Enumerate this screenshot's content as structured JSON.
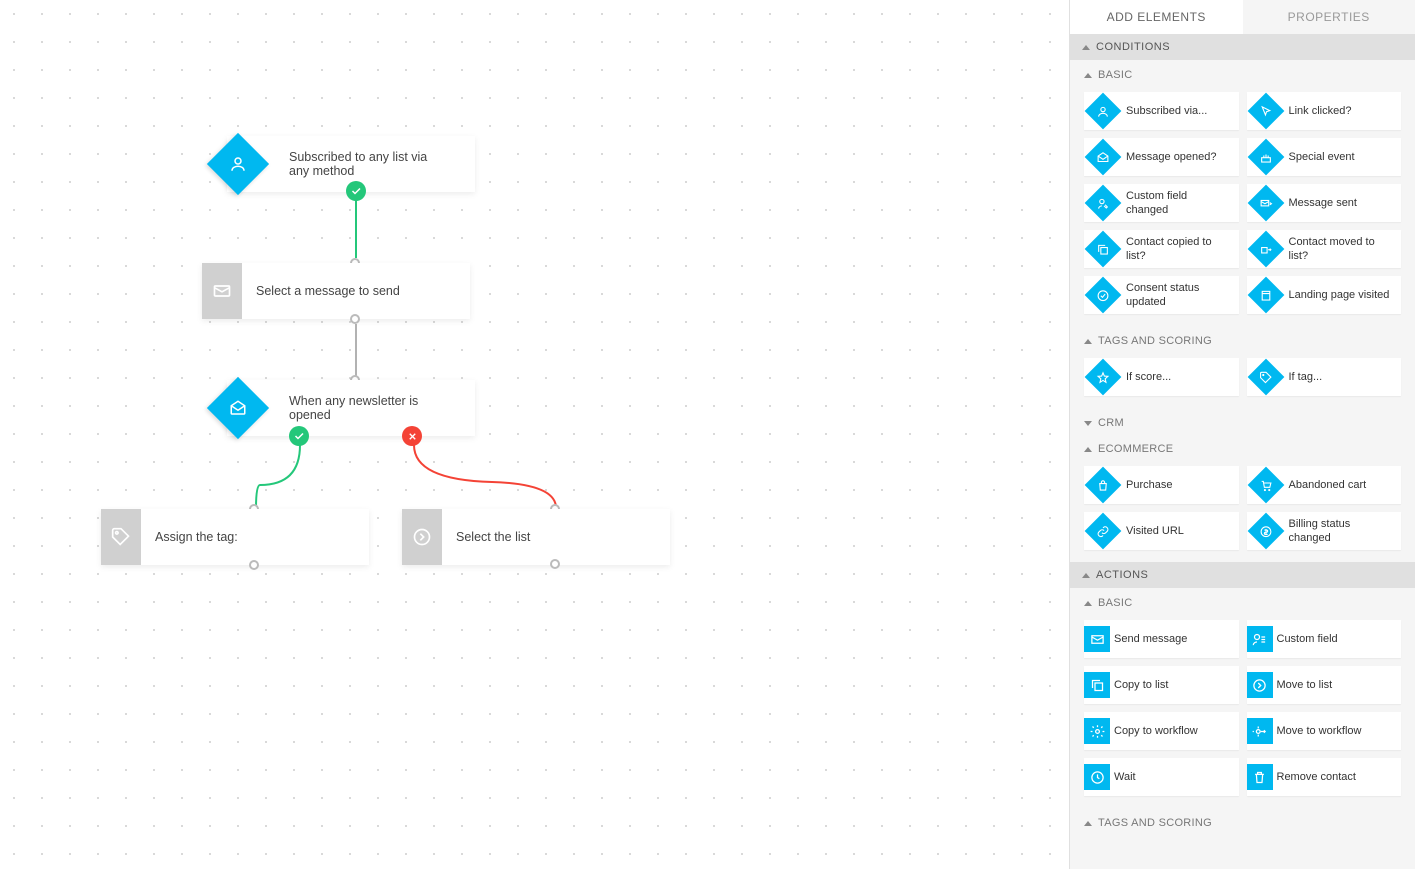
{
  "tabs": {
    "add": "ADD ELEMENTS",
    "props": "PROPERTIES"
  },
  "sections": {
    "conditions": "CONDITIONS",
    "actions": "ACTIONS",
    "basic": "BASIC",
    "tags_scoring": "TAGS AND SCORING",
    "crm": "CRM",
    "ecommerce": "ECOMMERCE"
  },
  "cond": {
    "subscribed": "Subscribed via...",
    "link_clicked": "Link clicked?",
    "msg_opened": "Message opened?",
    "special_event": "Special event",
    "custom_field": "Custom field changed",
    "msg_sent": "Message sent",
    "copied": "Contact copied to list?",
    "moved": "Contact moved to list?",
    "consent": "Consent status updated",
    "landing": "Landing page visited",
    "if_score": "If score...",
    "if_tag": "If tag...",
    "purchase": "Purchase",
    "abandoned": "Abandoned cart",
    "visited_url": "Visited URL",
    "billing": "Billing status changed"
  },
  "act": {
    "send_msg": "Send message",
    "custom_field": "Custom field",
    "copy_list": "Copy to list",
    "move_list": "Move to list",
    "copy_wf": "Copy to workflow",
    "move_wf": "Move to workflow",
    "wait": "Wait",
    "remove": "Remove contact"
  },
  "nodes": {
    "n1": "Subscribed to any list via any method",
    "n2": "Select a message to send",
    "n3": "When any newsletter is opened",
    "n4": "Assign the tag:",
    "n5": "Select the list"
  }
}
